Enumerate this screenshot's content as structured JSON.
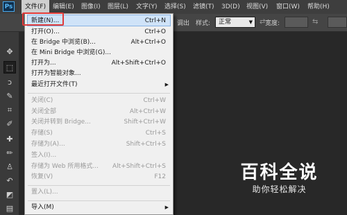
{
  "app": {
    "logo": "Ps"
  },
  "menubar": {
    "items": [
      "文件(F)",
      "编辑(E)",
      "图像(I)",
      "图层(L)",
      "文字(Y)",
      "选择(S)",
      "滤镜(T)",
      "3D(D)",
      "视图(V)",
      "窗口(W)",
      "帮助(H)"
    ]
  },
  "options": {
    "partial_label": "调出",
    "style_label": "样式:",
    "style_value": "正常",
    "width_label": "宽度:"
  },
  "file_menu": {
    "items": [
      {
        "label": "新建(N)...",
        "shortcut": "Ctrl+N"
      },
      {
        "label": "打开(O)...",
        "shortcut": "Ctrl+O"
      },
      {
        "label": "在 Bridge 中浏览(B)...",
        "shortcut": "Alt+Ctrl+O"
      },
      {
        "label": "在 Mini Bridge 中浏览(G)...",
        "shortcut": ""
      },
      {
        "label": "打开为...",
        "shortcut": "Alt+Shift+Ctrl+O"
      },
      {
        "label": "打开为智能对象...",
        "shortcut": ""
      },
      {
        "label": "最近打开文件(T)",
        "shortcut": ""
      },
      {
        "label": "关闭(C)",
        "shortcut": "Ctrl+W"
      },
      {
        "label": "关闭全部",
        "shortcut": "Alt+Ctrl+W"
      },
      {
        "label": "关闭并转到 Bridge...",
        "shortcut": "Shift+Ctrl+W"
      },
      {
        "label": "存储(S)",
        "shortcut": "Ctrl+S"
      },
      {
        "label": "存储为(A)...",
        "shortcut": "Shift+Ctrl+S"
      },
      {
        "label": "签入(I)...",
        "shortcut": ""
      },
      {
        "label": "存储为 Web 所用格式...",
        "shortcut": "Alt+Shift+Ctrl+S"
      },
      {
        "label": "恢复(V)",
        "shortcut": "F12"
      },
      {
        "label": "置入(L)...",
        "shortcut": ""
      },
      {
        "label": "导入(M)",
        "shortcut": ""
      }
    ]
  },
  "watermark": {
    "title": "百科全说",
    "subtitle": "助你轻松解决"
  },
  "colors": {
    "menu_bg": "#f0f0f0",
    "highlight": "#cfe3f8",
    "annotation": "#e03a3a",
    "workspace": "#282828"
  }
}
